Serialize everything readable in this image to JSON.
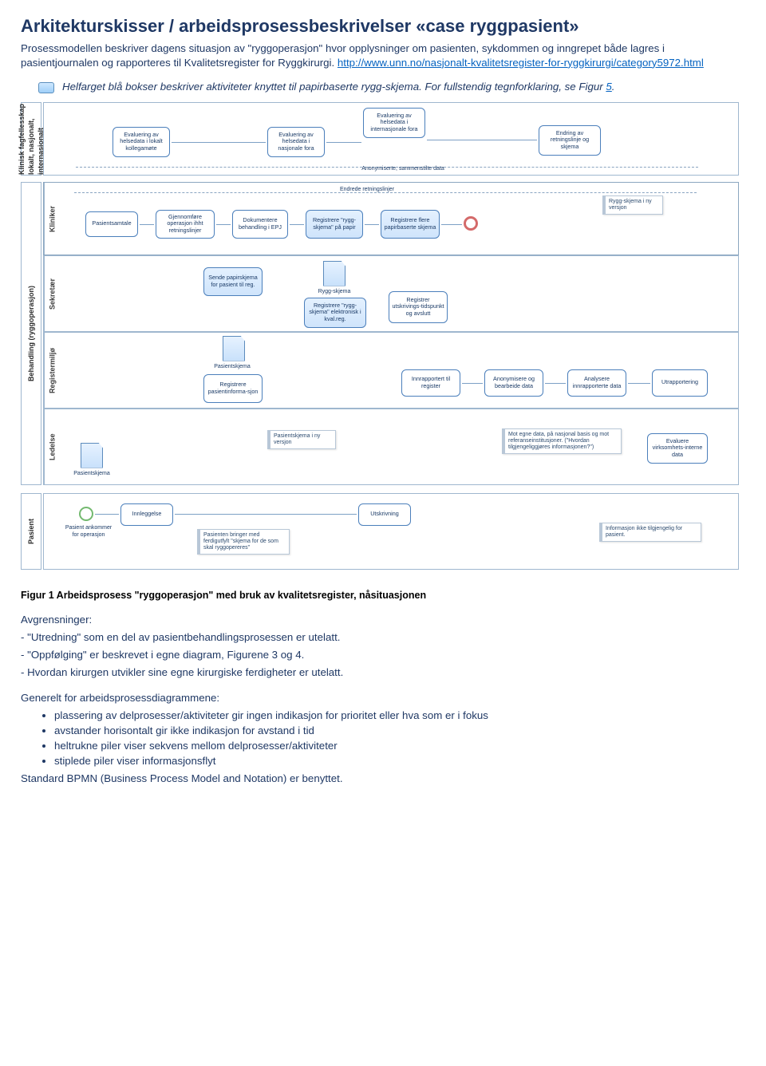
{
  "title": "Arkitekturskisser / arbeidsprosessbeskrivelser «case ryggpasient»",
  "intro": {
    "p1": "Prosessmodellen beskriver dagens situasjon av \"ryggoperasjon\" hvor opplysninger om pasienten, sykdommen og inngrepet både lagres i pasientjournalen og rapporteres til Kvalitetsregister for Ryggkirurgi. ",
    "link_text": "http://www.unn.no/nasjonalt-kvalitetsregister-for-ryggkirurgi/category5972.html"
  },
  "legend": {
    "text_before": "Helfarget blå bokser beskriver aktiviteter knyttet til papirbaserte rygg-skjema. For fullstendig tegnforklaring, se Figur ",
    "link": "5",
    "text_after": "."
  },
  "pools": {
    "top": "Klinisk fagfellesskap\nlokalt, nasjonalt,\ninternasjonalt",
    "mid": "Behandling (ryggoperasjon)"
  },
  "lanes": {
    "kliniker": "Kliniker",
    "sekretaer": "Sekretær",
    "registermiljo": "Registermiljø",
    "ledelse": "Ledelse",
    "pasient": "Pasient"
  },
  "topRow": {
    "b1": "Evaluering av helsedata i lokalt kollegamøte",
    "b2": "Evaluering av helsedata i nasjonale fora",
    "b3": "Evaluering av helsedata i internasjonale fora",
    "b4": "Endring av retningslinje og skjema",
    "centerLabel": "Anonymiserte, sammenstilte data"
  },
  "kliniker": {
    "b1": "Pasientsamtale",
    "b2": "Gjennomføre operasjon ihht retningslinjer",
    "b3": "Dokumentere behandling i EPJ",
    "b4": "Registrere \"rygg-skjema\" på papir",
    "b5": "Registrere flere papirbaserte skjema",
    "noteR": "Rygg-skjema i ny versjon",
    "topLine": "Endrede retningslinjer"
  },
  "sekretaer": {
    "b1": "Sende papirskjema for pasient til reg.",
    "docR": "Rygg-skjema",
    "b2": "Registrere \"rygg-skjema\" elektronisk i kval.reg.",
    "b3": "Registrer utskrivings-tidspunkt og avslutt"
  },
  "registermiljo": {
    "docP": "Pasientskjema",
    "b1": "Registrere pasientinforma-sjon",
    "b2": "Innrapportert til register",
    "b3": "Anonymisere og bearbeide data",
    "b4": "Analysere innrapporterte data",
    "b5": "Utrapportering"
  },
  "ledelse": {
    "docP": "Pasientskjema",
    "note1": "Pasientskjema i ny versjon",
    "note2": "Mot egne data, på nasjonal basis og mot referanseinstitusjoner. (\"Hvordan tilgjengeliggjøres informasjonen?\")",
    "b1": "Evaluere virksomhets-interne data"
  },
  "pasient": {
    "start": "Pasient ankommer for operasjon",
    "b1": "Innleggelse",
    "note1": "Pasienten bringer med ferdigutfylt \"skjema for de som skal ryggopereres\"",
    "b2": "Utskrivning",
    "noteR": "Informasjon ikke tilgjengelig for pasient."
  },
  "caption": "Figur 1 Arbeidsprosess \"ryggoperasjon\" med bruk av kvalitetsregister, nåsituasjonen",
  "limits": {
    "h": "Avgrensninger:",
    "l1": "- \"Utredning\" som en del av pasientbehandlingsprosessen er utelatt.",
    "l2": "- \"Oppfølging\" er beskrevet i egne diagram, Figurene 3 og 4.",
    "l3": "- Hvordan kirurgen utvikler sine egne kirurgiske ferdigheter er utelatt."
  },
  "general": {
    "h": "Generelt for arbeidsprosessdiagrammene:",
    "b1": "plassering av delprosesser/aktiviteter gir ingen indikasjon for prioritet eller hva som er i fokus",
    "b2": "avstander horisontalt gir ikke indikasjon for avstand i tid",
    "b3": "heltrukne piler viser sekvens mellom delprosesser/aktiviteter",
    "b4": "stiplede piler viser informasjonsflyt",
    "foot": "Standard BPMN (Business Process Model and Notation) er benyttet."
  }
}
